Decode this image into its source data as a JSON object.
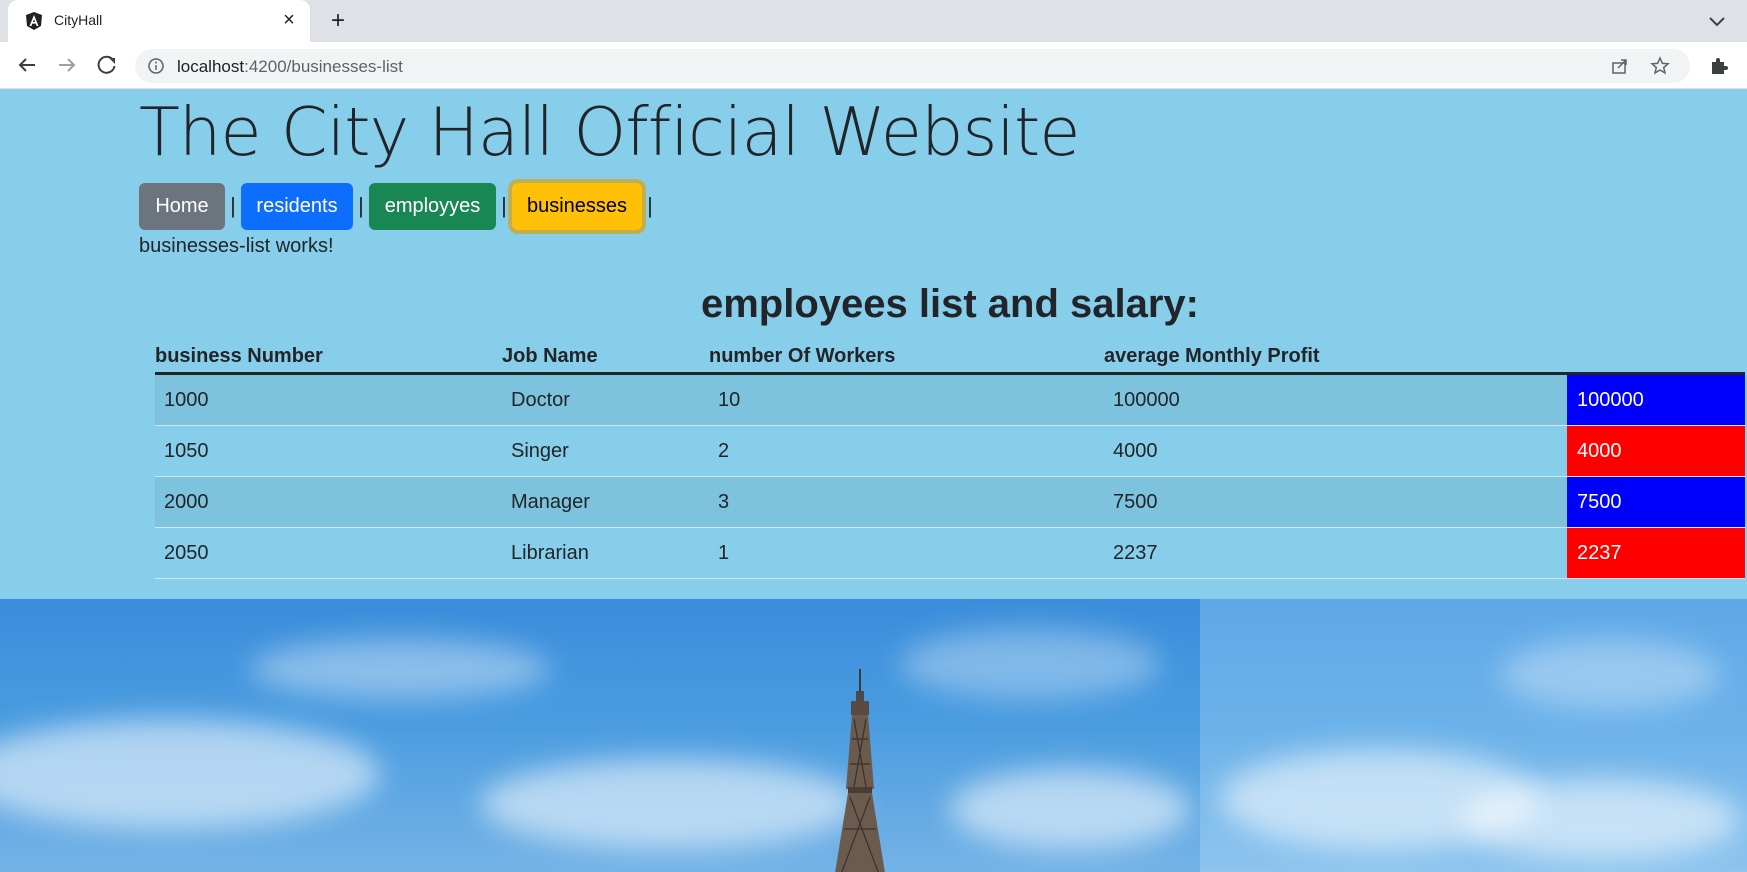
{
  "browser": {
    "tab_title": "CityHall",
    "url_host": "localhost",
    "url_path": ":4200/businesses-list"
  },
  "page": {
    "title": "The City Hall Official Website",
    "nav": {
      "home": "Home",
      "residents": "residents",
      "employees": "employyes",
      "businesses": "businesses",
      "separator": "|"
    },
    "works_text": "businesses-list works!",
    "list_title": "employees list and salary:"
  },
  "table": {
    "headers": [
      "business Number",
      "Job Name",
      "number Of Workers",
      "average Monthly Profit",
      ""
    ],
    "rows": [
      {
        "number": "1000",
        "job": "Doctor",
        "workers": "10",
        "profit": "100000",
        "badge": "100000",
        "badge_color": "#0000ff"
      },
      {
        "number": "1050",
        "job": "Singer",
        "workers": "2",
        "profit": "4000",
        "badge": "4000",
        "badge_color": "#ff0000"
      },
      {
        "number": "2000",
        "job": "Manager",
        "workers": "3",
        "profit": "7500",
        "badge": "7500",
        "badge_color": "#0000ff"
      },
      {
        "number": "2050",
        "job": "Librarian",
        "workers": "1",
        "profit": "2237",
        "badge": "2237",
        "badge_color": "#ff0000"
      }
    ]
  },
  "colors": {
    "page_bg": "#87ceeb",
    "btn_home": "#6c757d",
    "btn_residents": "#0d6efd",
    "btn_employees": "#198754",
    "btn_businesses": "#ffc107",
    "badge_high": "#0000ff",
    "badge_low": "#ff0000"
  }
}
